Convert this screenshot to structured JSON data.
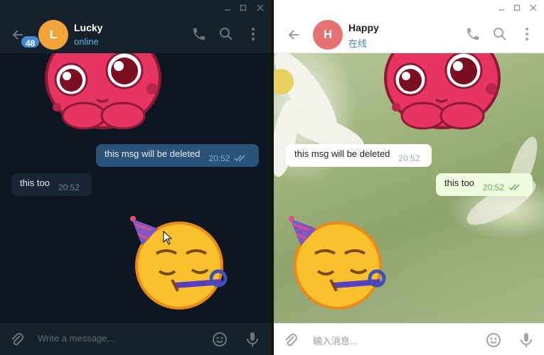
{
  "left": {
    "contact": {
      "initial": "L",
      "name": "Lucky",
      "status": "online"
    },
    "unread_badge": "48",
    "messages": [
      {
        "text": "this msg will be deleted",
        "time": "20:52",
        "outgoing": true
      },
      {
        "text": "this too",
        "time": "20:52",
        "outgoing": false
      }
    ],
    "composer_placeholder": "Write a message...",
    "colors": {
      "bg": "#0e1621",
      "panel": "#17212b",
      "outgoing": "#2b5278",
      "incoming": "#182533",
      "accent": "#6ab2f2"
    }
  },
  "right": {
    "contact": {
      "initial": "H",
      "name": "Happy",
      "status": "在线"
    },
    "messages": [
      {
        "text": "this msg will be deleted",
        "time": "20:52",
        "outgoing": false
      },
      {
        "text": "this too",
        "time": "20:52",
        "outgoing": true
      }
    ],
    "composer_placeholder": "输入消息...",
    "colors": {
      "panel": "#ffffff",
      "outgoing": "#effdde",
      "incoming": "#ffffff",
      "accent": "#3a8ac7"
    }
  },
  "icons": {
    "back": "arrow-left-icon",
    "call": "phone-icon",
    "search": "search-icon",
    "more": "more-vertical-icon",
    "attach": "paperclip-icon",
    "emoji": "smile-icon",
    "voice": "microphone-icon",
    "sticker_top": "pink-octopus-sticker",
    "sticker_bottom": "party-face-sticker"
  }
}
